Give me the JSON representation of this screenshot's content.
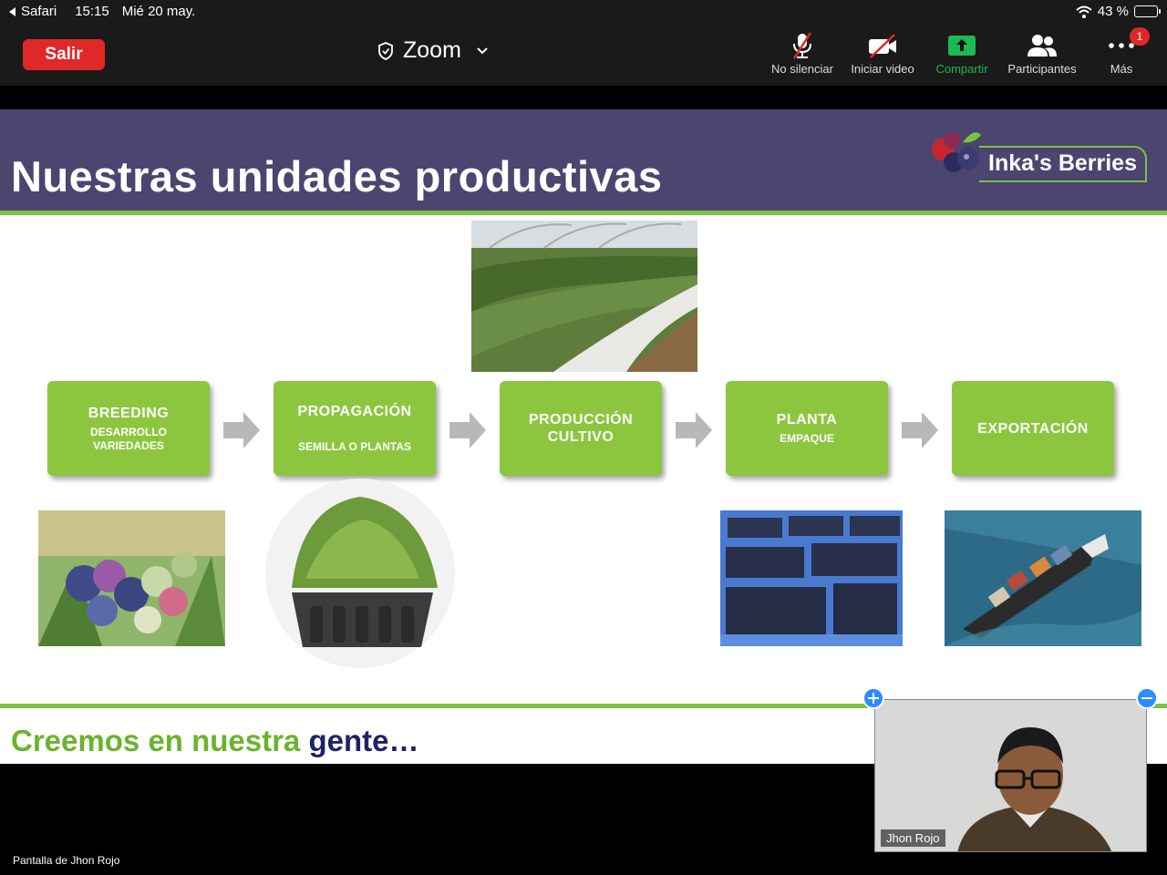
{
  "status_bar": {
    "back_app": "Safari",
    "time": "15:15",
    "date": "Mié 20 may.",
    "battery_text": "43 %",
    "battery_level": 0.43
  },
  "toolbar": {
    "leave_label": "Salir",
    "meeting_title": "Zoom",
    "items": [
      {
        "label": "No silenciar",
        "icon": "muted-mic-icon"
      },
      {
        "label": "Iniciar video",
        "icon": "video-off-icon"
      },
      {
        "label": "Compartir",
        "icon": "share-screen-icon"
      },
      {
        "label": "Participantes",
        "icon": "participants-icon"
      },
      {
        "label": "Más",
        "icon": "more-icon",
        "badge": "1"
      }
    ],
    "share_color": "#1db954"
  },
  "slide": {
    "title": "Nuestras unidades productivas",
    "logo_text": "Inka's Berries",
    "steps": [
      {
        "title": "BREEDING",
        "subtitle": "DESARROLLO VARIEDADES"
      },
      {
        "title": "PROPAGACIÓN",
        "subtitle": "SEMILLA O PLANTAS"
      },
      {
        "title": "PRODUCCIÓN CULTIVO",
        "subtitle": ""
      },
      {
        "title": "PLANTA",
        "subtitle": "EMPAQUE"
      },
      {
        "title": "EXPORTACIÓN",
        "subtitle": ""
      }
    ],
    "tagline_green": "Creemos en nuestra",
    "tagline_blue": "gente…",
    "header_color": "#4b456f",
    "accent_color": "#8cc63f"
  },
  "video": {
    "participant_name": "Jhon Rojo"
  },
  "share_label": "Pantalla de Jhon Rojo"
}
